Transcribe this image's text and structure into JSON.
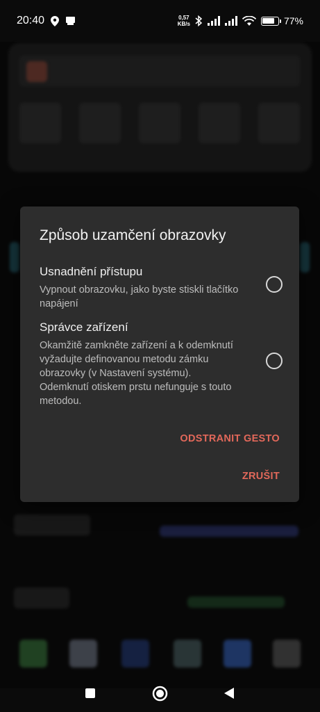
{
  "status_bar": {
    "time": "20:40",
    "net_speed_value": "0,57",
    "net_speed_unit": "KB/s",
    "battery_percent": "77%",
    "battery_level": 0.77,
    "icons": [
      "location-icon",
      "notification-icon",
      "bluetooth-icon",
      "signal-icon",
      "signal-icon",
      "wifi-icon",
      "battery-icon"
    ]
  },
  "dialog": {
    "title": "Způsob uzamčení obrazovky",
    "options": [
      {
        "title": "Usnadnění přístupu",
        "description": "Vypnout obrazovku, jako byste stiskli tlačítko napájení",
        "selected": false
      },
      {
        "title": "Správce zařízení",
        "description": "Okamžitě zamkněte zařízení a k odemknutí vyžadujte definovanou metodu zámku obrazovky (v Nastavení systému). Odemknutí otiskem prstu nefunguje s touto metodou.",
        "selected": false
      }
    ],
    "remove_gesture_label": "ODSTRANIT GESTO",
    "cancel_label": "ZRUŠIT",
    "accent_color": "#e2685a"
  },
  "navbar": {
    "icons": [
      "recents-square-icon",
      "home-circle-icon",
      "back-triangle-icon"
    ]
  }
}
